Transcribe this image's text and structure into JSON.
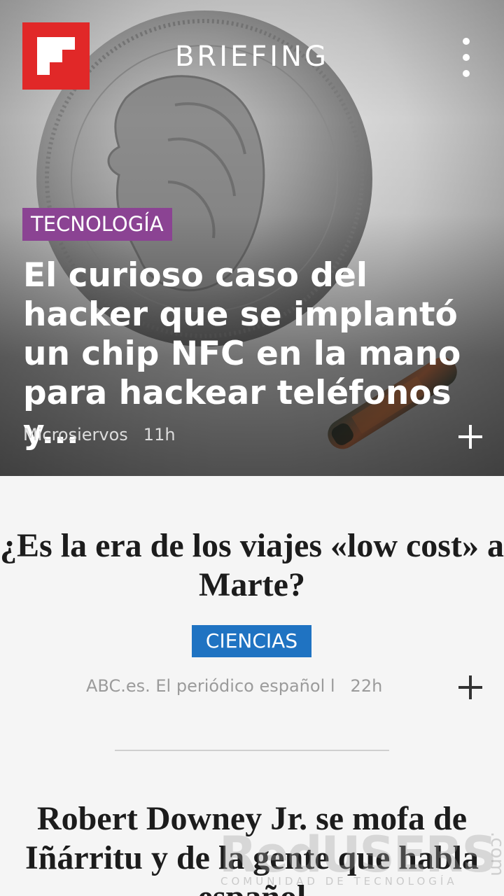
{
  "app": {
    "title": "BRIEFING"
  },
  "hero": {
    "category": "TECNOLOGÍA",
    "category_color": "#8b4393",
    "headline": "El curioso caso del hacker que se implantó un chip NFC en la mano para hackear teléfonos y...",
    "source": "Microsiervos",
    "time": "11h"
  },
  "articles": [
    {
      "headline": "¿Es la era de los viajes «low cost» a Marte?",
      "category": "CIENCIAS",
      "category_color": "#1f73c2",
      "source": "ABC.es. El periódico español l",
      "time": "22h"
    },
    {
      "headline": "Robert Downey Jr. se mofa de Iñárritu y de la gente que habla español"
    }
  ],
  "watermark": {
    "brand": "RedUSERS",
    "tagline": "COMUNIDAD DE TECNOLOGÍA",
    "suffix": ".com"
  },
  "icons": [
    "flipboard-logo",
    "overflow-menu-icon",
    "plus-icon"
  ],
  "colors": {
    "brand_red": "#e12828",
    "tech_tag": "#8b4393",
    "science_tag": "#1f73c2"
  }
}
